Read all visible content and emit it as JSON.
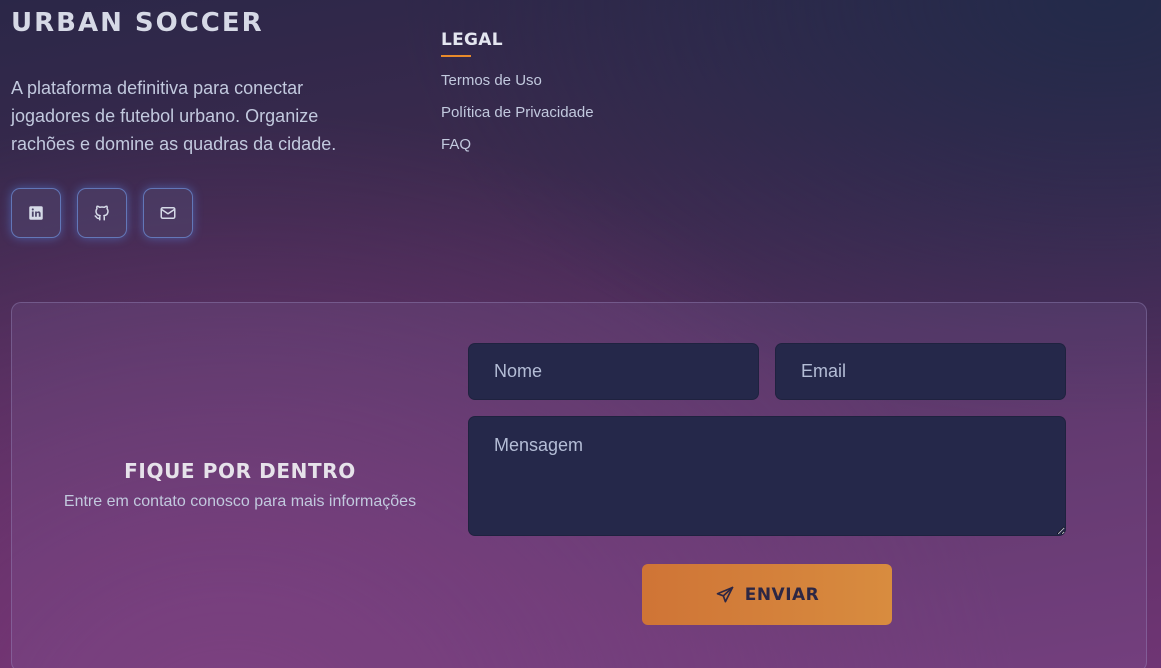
{
  "brand": {
    "name": "URBAN SOCCER"
  },
  "tagline": "A plataforma definitiva para conectar jogadores de futebol urbano. Organize rachões e domine as quadras da cidade.",
  "socials": [
    {
      "icon": "linkedin-icon"
    },
    {
      "icon": "github-icon"
    },
    {
      "icon": "mail-icon"
    }
  ],
  "legal": {
    "title": "LEGAL",
    "links": [
      "Termos de Uso",
      "Política de Privacidade",
      "FAQ"
    ]
  },
  "contact": {
    "heading": "FIQUE POR DENTRO",
    "subtitle": "Entre em contato conosco para mais informações",
    "name_placeholder": "Nome",
    "email_placeholder": "Email",
    "message_placeholder": "Mensagem",
    "send_label": "ENVIAR",
    "send_icon": "send-icon"
  },
  "colors": {
    "accent": "#e88a2a",
    "button": "#d88c3f",
    "field_bg": "#25284a"
  }
}
